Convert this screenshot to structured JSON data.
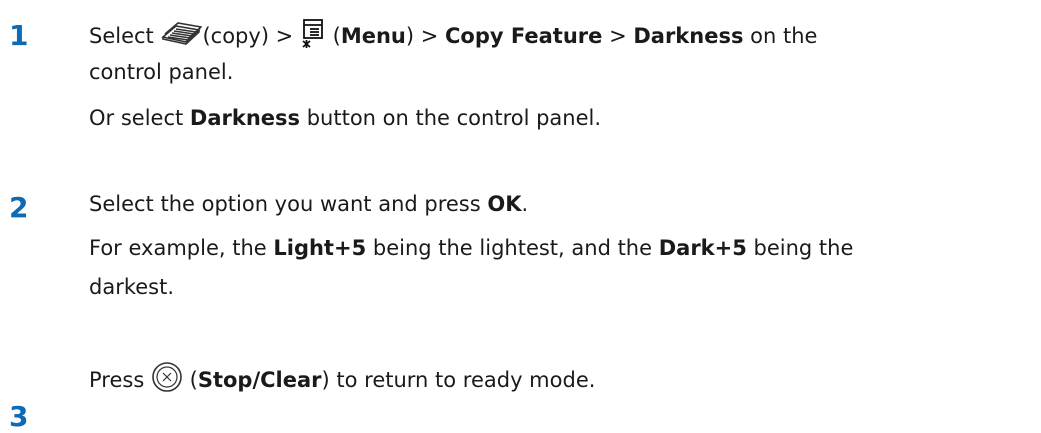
{
  "steps": [
    {
      "number": "1",
      "line1": {
        "select": "Select ",
        "copy_paren": "(copy) > ",
        "open_paren": " (",
        "menu": "Menu",
        "close_gt": ") > ",
        "copy_feature": "Copy Feature",
        "gt": " > ",
        "darkness": "Darkness",
        "tail": " on the"
      },
      "line2": "control panel.",
      "alt": {
        "prefix": "Or select ",
        "bold": "Darkness",
        "suffix": " button on the control panel."
      }
    },
    {
      "number": "2",
      "line1": {
        "prefix": "Select the option you want and press ",
        "ok": "OK",
        "suffix": "."
      },
      "example": {
        "prefix": "For example, the ",
        "light": "Light+5",
        "middle": " being the lightest, and the ",
        "dark": "Dark+5",
        "suffix": " being the"
      },
      "example_line2": "darkest."
    },
    {
      "number": "3",
      "line1": {
        "press": "Press ",
        "open_paren": " (",
        "stop_clear": "Stop/Clear",
        "suffix": ") to return to ready mode."
      }
    }
  ],
  "icons": [
    "copy-icon",
    "menu-icon",
    "stop-clear-icon"
  ]
}
